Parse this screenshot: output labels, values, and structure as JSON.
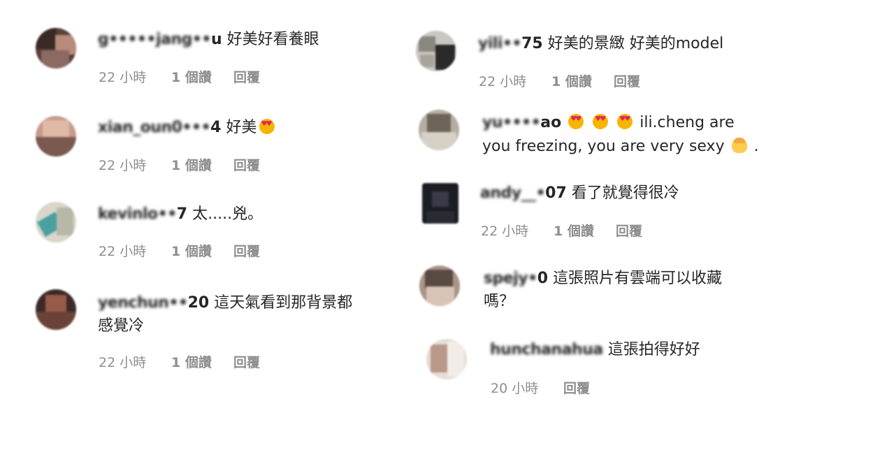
{
  "comments_left": [
    {
      "username_obscured": "g•••••jang••",
      "username_tail": "u",
      "text": "好美好看養眼",
      "time": "22 小時",
      "likes": "1 個讚",
      "reply": "回覆"
    },
    {
      "username_obscured": "xian_oun0•••",
      "username_tail": "4",
      "text": "好美",
      "time": "22 小時",
      "likes": "1 個讚",
      "reply": "回覆"
    },
    {
      "username_obscured": "kevinlo••",
      "username_tail": "7",
      "text": "太.....兇。",
      "time": "22 小時",
      "likes": "1 個讚",
      "reply": "回覆"
    },
    {
      "username_obscured": "yenchun••",
      "username_tail": "20",
      "text_line1": "這天氣看到那背景都",
      "text_line2": "感覺冷",
      "time": "22 小時",
      "likes": "1 個讚",
      "reply": "回覆"
    }
  ],
  "comments_right": [
    {
      "username_obscured": "yili••",
      "username_tail": "75",
      "text": "好美的景緻 好美的model",
      "time": "22 小時",
      "likes": "1 個讚",
      "reply": "回覆"
    },
    {
      "username_obscured": "yu••••",
      "username_tail": "ao",
      "text_line1": "ili.cheng are",
      "text_line2": "you freezing, you are very sexy",
      "text_line2_end": ".",
      "time": "",
      "likes": "",
      "reply": ""
    },
    {
      "username_obscured": "andy__•",
      "username_tail": "07",
      "text": "看了就覺得很冷",
      "time": "22 小時",
      "likes": "1 個讚",
      "reply": "回覆"
    },
    {
      "username_obscured": "spejy•",
      "username_tail": "0",
      "text_line1": "這張照片有雲端可以收藏",
      "text_line2": "嗎？",
      "time": "",
      "likes": "",
      "reply": ""
    },
    {
      "username_obscured": "hunchanahua",
      "username_tail": "",
      "text": "這張拍得好好",
      "time": "20 小時",
      "likes": "",
      "reply": "回覆"
    }
  ],
  "icons": {
    "heart_eyes": "smiling-face-with-heart-eyes-icon",
    "person": "person-blond-emoji-icon"
  },
  "colors": {
    "text": "#262626",
    "meta": "#8e8e8e"
  }
}
